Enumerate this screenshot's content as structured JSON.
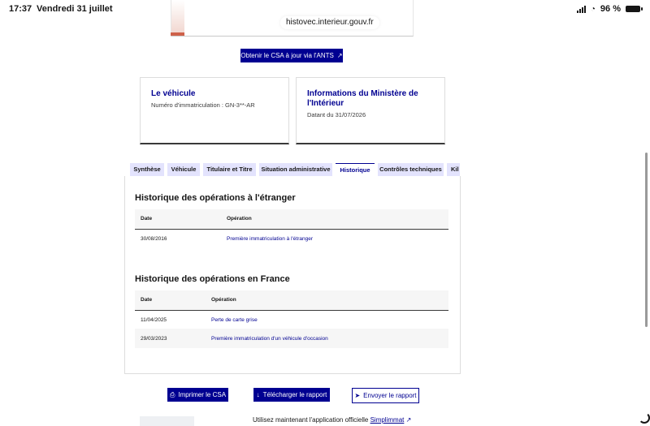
{
  "status": {
    "time": "17:37",
    "date": "Vendredi 31 juillet",
    "battery": "96 %"
  },
  "browser": {
    "url": "histovec.interieur.gouv.fr"
  },
  "ants_button": {
    "label": "Obtenir le CSA à jour via l'ANTS"
  },
  "cards": {
    "vehicle": {
      "title": "Le véhicule",
      "desc": "Numéro d'immatriculation : GN-3**-AR"
    },
    "ministry": {
      "title_line1": "Informations du Ministère de",
      "title_line2": "l'Intérieur",
      "desc": "Datant du 31/07/2026"
    }
  },
  "tabs": [
    "Synthèse",
    "Véhicule",
    "Titulaire et Titre",
    "Situation administrative",
    "Historique",
    "Contrôles techniques",
    "Kil"
  ],
  "active_tab": "Historique",
  "foreign": {
    "title": "Historique des opérations à l'étranger",
    "col_date": "Date",
    "col_operation": "Opération",
    "rows": [
      {
        "date": "30/08/2016",
        "operation": "Première immatriculation à l'étranger"
      }
    ]
  },
  "france": {
    "title": "Historique des opérations en France",
    "col_date": "Date",
    "col_operation": "Opération",
    "rows": [
      {
        "date": "11/04/2025",
        "operation": "Perte de carte grise"
      },
      {
        "date": "29/03/2023",
        "operation": "Première immatriculation d'un véhicule d'occasion"
      }
    ]
  },
  "actions": {
    "print": "Imprimer le CSA",
    "download": "Télécharger le rapport",
    "send": "Envoyer le rapport"
  },
  "footer": {
    "text": "Utilisez maintenant l'application officielle",
    "link": "Simplimmat"
  },
  "colors": {
    "primary": "#000091",
    "tab_bg": "#e3e3fd",
    "accent": "#ce614a"
  }
}
